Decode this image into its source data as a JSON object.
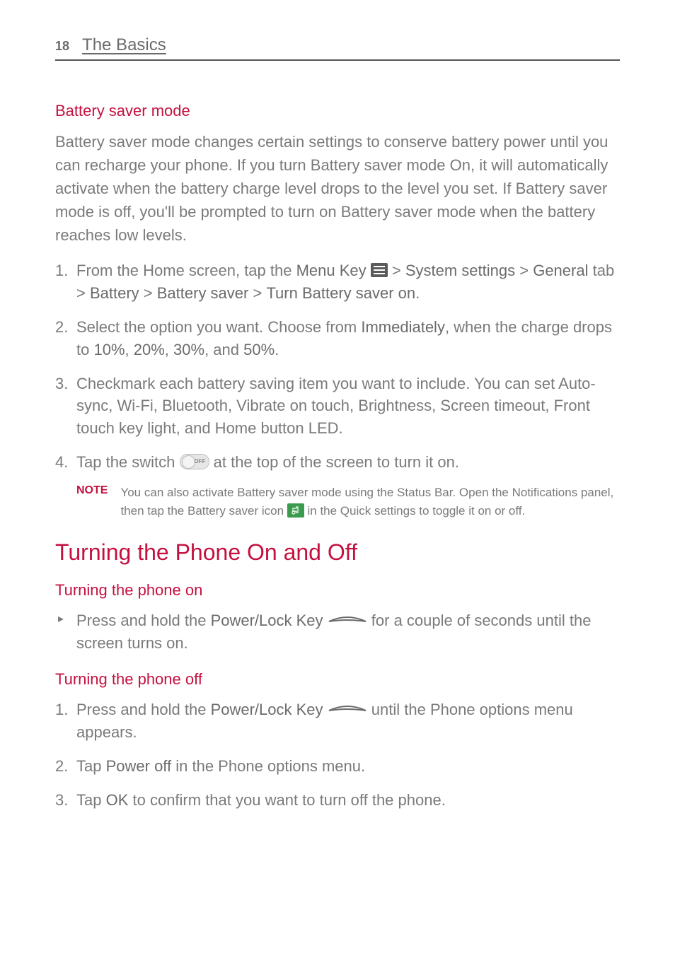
{
  "header": {
    "page_number": "18",
    "chapter_title": "The Basics"
  },
  "section1": {
    "heading": "Battery saver mode",
    "intro": "Battery saver mode changes certain settings to conserve battery power until you can recharge your phone. If you turn Battery saver mode On, it will automatically activate when the battery charge level drops to the level you set. If Battery saver mode is off, you'll be prompted to turn on Battery saver mode when the battery reaches low levels.",
    "step1": {
      "pre": "From the Home screen, tap the ",
      "menu_key": "Menu Key",
      "mid1": " > ",
      "system_settings": "System settings",
      "mid2": " > ",
      "general": "General",
      "tab_text": " tab > ",
      "battery": "Battery",
      "gt1": " > ",
      "battery_saver": "Battery saver",
      "gt2": " > ",
      "turn_on": "Turn Battery saver on",
      "tail": "."
    },
    "step2": {
      "pre": "Select the option you want. Choose from ",
      "immediately": "Immediately",
      "mid": ", when the charge drops to ",
      "p10": "10%",
      "c1": ", ",
      "p20": "20%",
      "c2": ", ",
      "p30": "30%",
      "c3": ", and ",
      "p50": "50%",
      "tail": "."
    },
    "step3": "Checkmark each battery saving item you want to include. You can set Auto-sync, Wi-Fi, Bluetooth, Vibrate on touch, Brightness, Screen timeout, Front touch key light, and Home button LED.",
    "step4": {
      "pre": "Tap the switch ",
      "post": " at the top of the screen to turn it on."
    },
    "note": {
      "label": "NOTE",
      "line1": "You can also activate Battery saver mode using the Status Bar. Open the Notifications panel, then tap the Battery saver icon ",
      "line2": " in the Quick settings to toggle it on or off."
    }
  },
  "section2": {
    "title": "Turning the Phone On and Off",
    "on": {
      "heading": "Turning the phone on",
      "pre": "Press and hold the ",
      "key": "Power/Lock Key",
      "post": " for a couple of seconds until the screen turns on."
    },
    "off": {
      "heading": "Turning the phone off",
      "s1_pre": "Press and hold the ",
      "s1_key": "Power/Lock Key",
      "s1_post": " until the Phone options menu appears.",
      "s2_pre": "Tap ",
      "s2_b": "Power off",
      "s2_post": " in the Phone options menu.",
      "s3_pre": "Tap ",
      "s3_b": "OK",
      "s3_post": " to confirm that you want to turn off the phone."
    }
  }
}
